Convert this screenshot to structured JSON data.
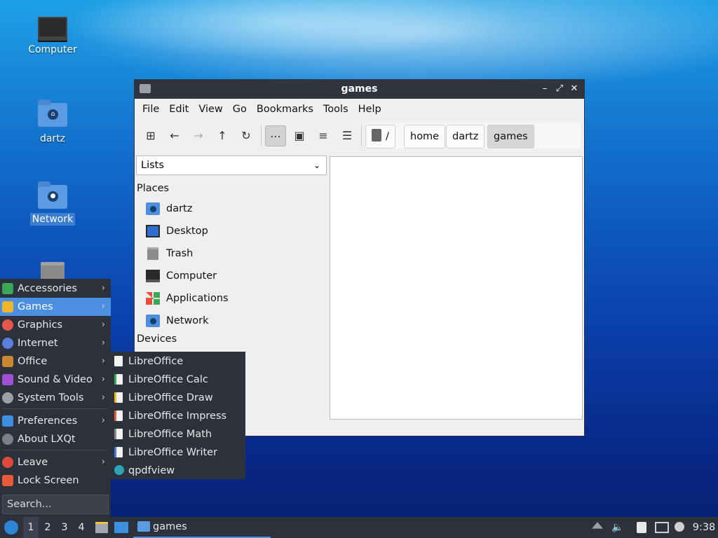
{
  "desktop": {
    "icons": [
      {
        "label": "Computer"
      },
      {
        "label": "dartz"
      },
      {
        "label": "Network"
      },
      {
        "label": ""
      }
    ]
  },
  "window": {
    "title": "games",
    "controls": {
      "minimize": "–",
      "maximize": "⤢",
      "close": "✕"
    },
    "menu": [
      "File",
      "Edit",
      "View",
      "Go",
      "Bookmarks",
      "Tools",
      "Help"
    ],
    "toolbar": {
      "new_tab": "⊞",
      "back": "←",
      "forward": "→",
      "up": "↑",
      "reload": "↻",
      "icon_view": "⋯",
      "thumb_view": "▣",
      "compact_view": "≡",
      "detail_view": "☰"
    },
    "path": [
      "/",
      "home",
      "dartz",
      "games"
    ],
    "side_mode": "Lists",
    "places_heading": "Places",
    "places": [
      "dartz",
      "Desktop",
      "Trash",
      "Computer",
      "Applications",
      "Network"
    ],
    "devices_heading": "Devices"
  },
  "start_menu": {
    "items": [
      {
        "label": "Accessories",
        "color": "#3aa657"
      },
      {
        "label": "Games",
        "color": "#f0b429"
      },
      {
        "label": "Graphics",
        "color": "#e8574a"
      },
      {
        "label": "Internet",
        "color": "#5b7fe0"
      },
      {
        "label": "Office",
        "color": "#c8892e"
      },
      {
        "label": "Sound & Video",
        "color": "#a24fd6"
      },
      {
        "label": "System Tools",
        "color": "#9aa0a8"
      },
      {
        "label": "Preferences",
        "color": "#3d8fe0"
      },
      {
        "label": "About LXQt",
        "color": "#7a7f88"
      },
      {
        "label": "Leave",
        "color": "#e04a3a"
      },
      {
        "label": "Lock Screen",
        "color": "#e85a3a"
      }
    ],
    "search_placeholder": "Search...",
    "highlighted": "Games"
  },
  "submenu": {
    "items": [
      "LibreOffice",
      "LibreOffice Calc",
      "LibreOffice Draw",
      "LibreOffice Impress",
      "LibreOffice Math",
      "LibreOffice Writer",
      "qpdfview"
    ]
  },
  "taskbar": {
    "workspaces": [
      "1",
      "2",
      "3",
      "4"
    ],
    "task_label": "games",
    "clock": "9:38"
  }
}
